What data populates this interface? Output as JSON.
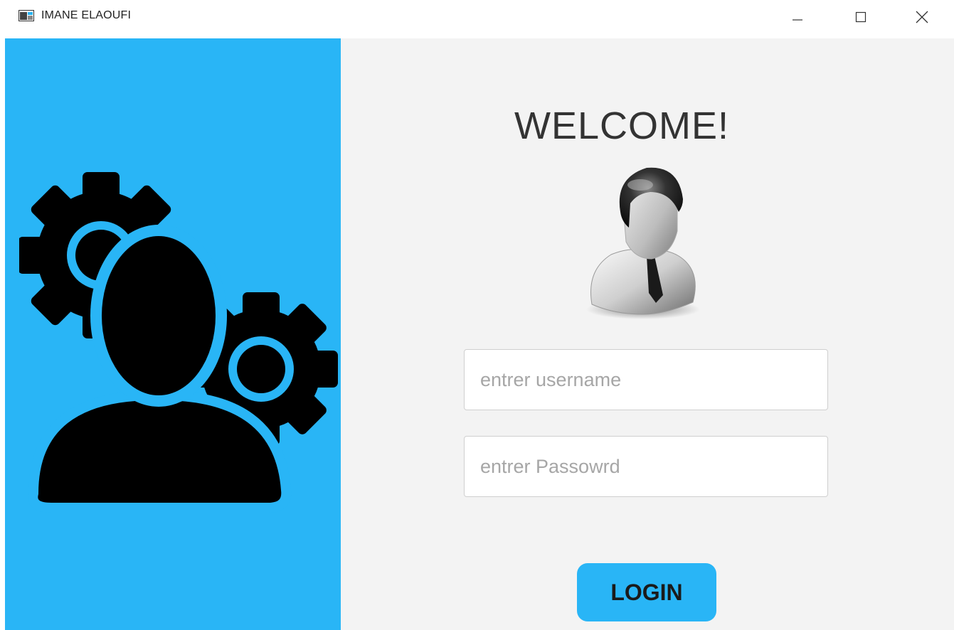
{
  "window": {
    "title": "IMANE ELAOUFI",
    "controls": [
      "minimize",
      "maximize",
      "close"
    ]
  },
  "left_panel": {
    "background": "#29b5f6",
    "illustration": "user-settings-icon"
  },
  "main": {
    "heading": "WELCOME!",
    "avatar": "user-avatar-icon",
    "username_field": {
      "value": "",
      "placeholder": "entrer username"
    },
    "password_field": {
      "value": "",
      "placeholder": "entrer Passowrd"
    },
    "login_button": {
      "label": "LOGIN",
      "color": "#29b5f6"
    }
  }
}
